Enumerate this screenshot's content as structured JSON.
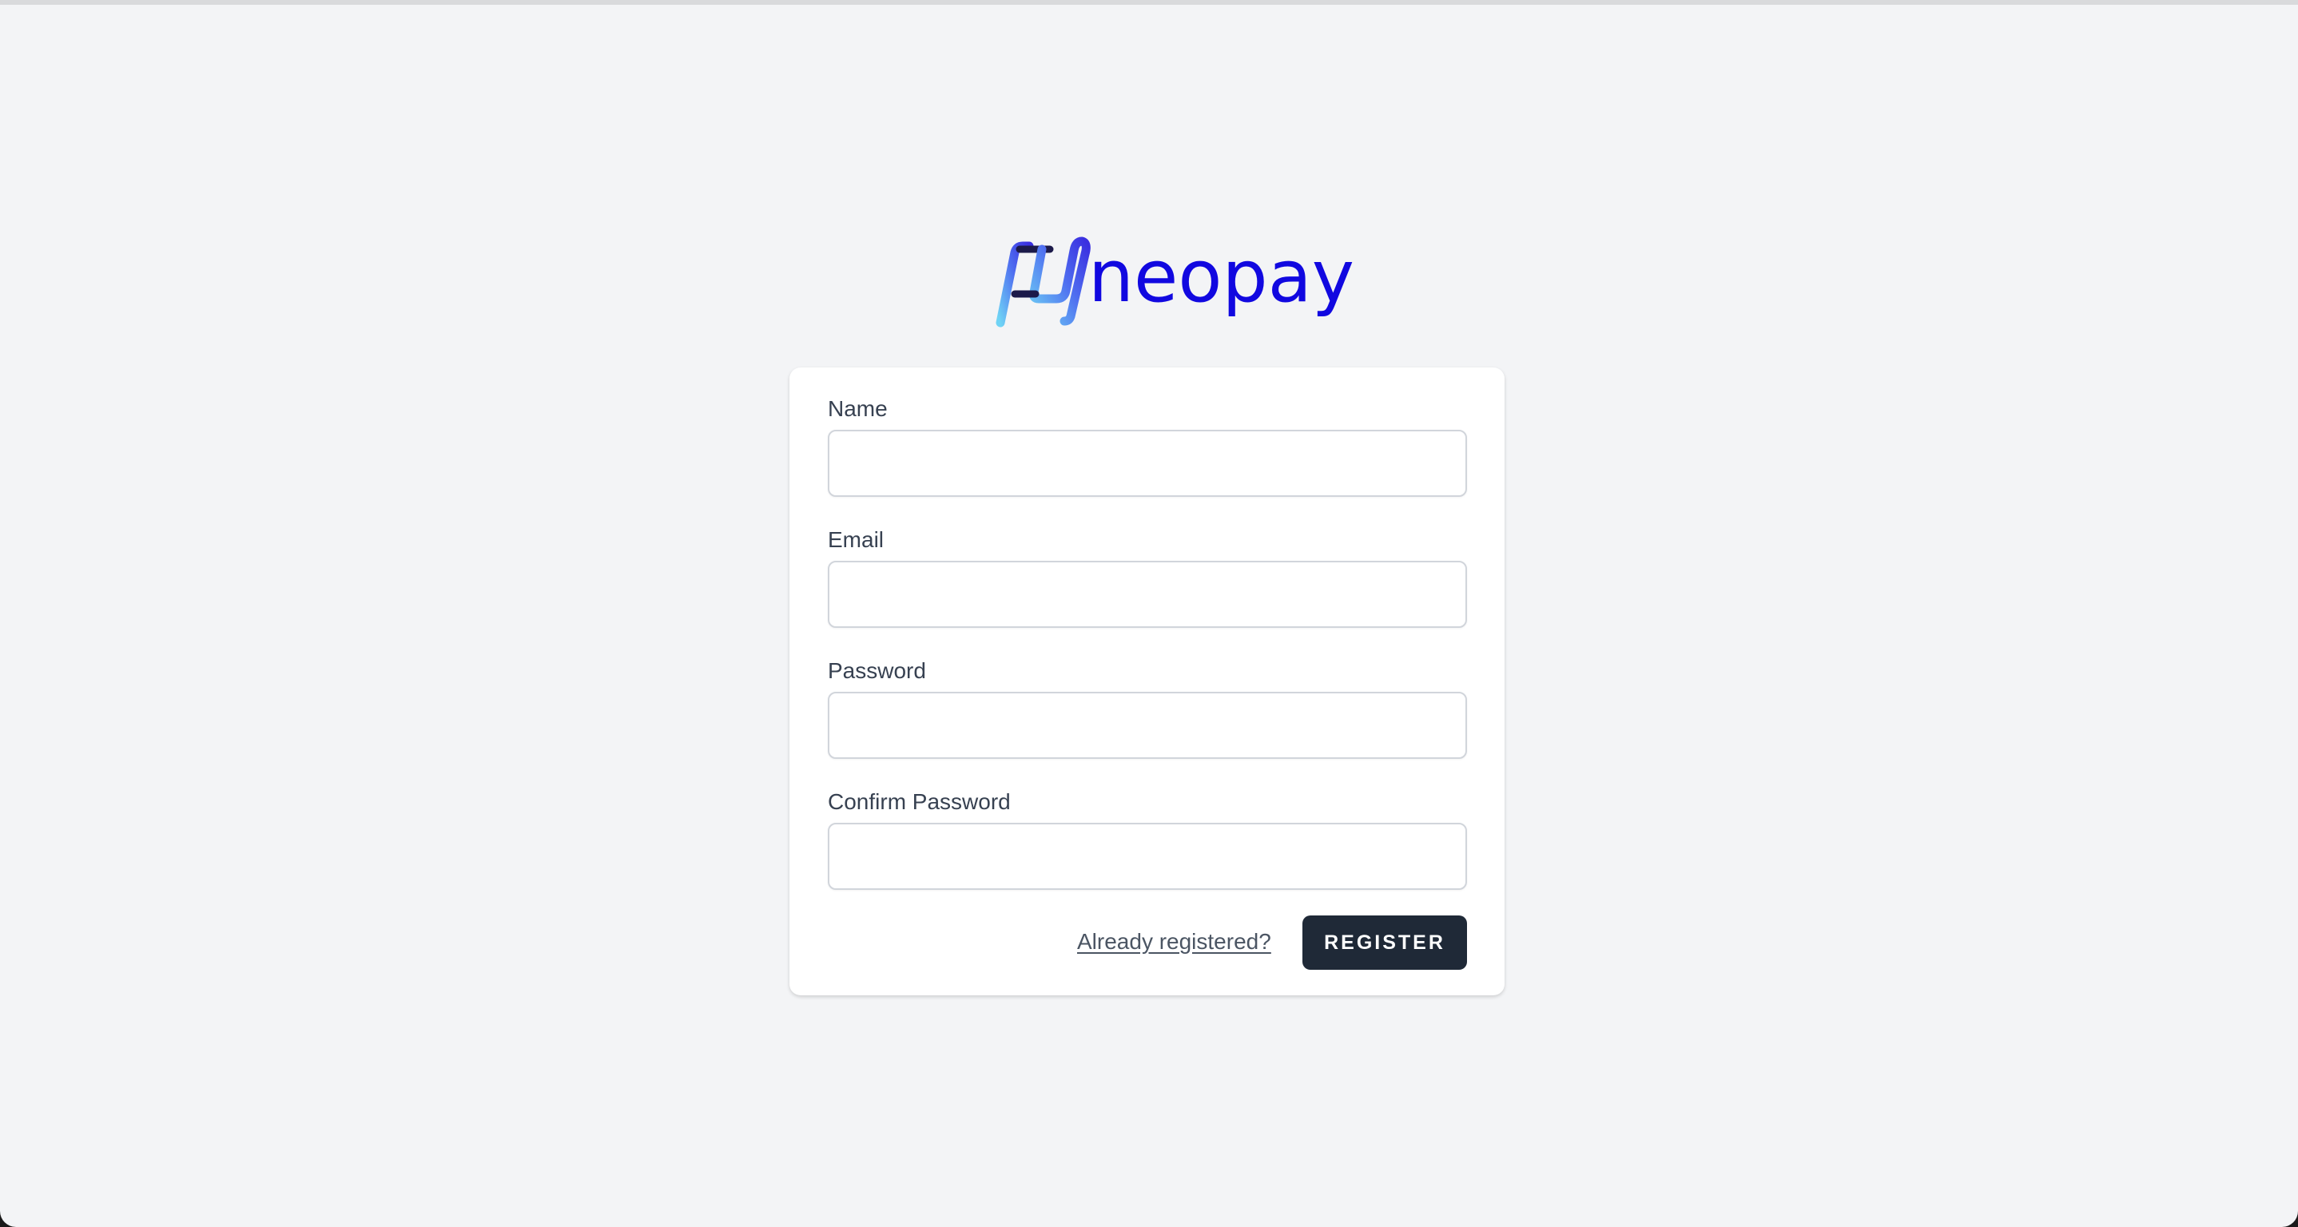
{
  "brand": {
    "name": "neopay",
    "color": "#1108e0"
  },
  "form": {
    "fields": [
      {
        "label": "Name",
        "value": "",
        "placeholder": ""
      },
      {
        "label": "Email",
        "value": "",
        "placeholder": ""
      },
      {
        "label": "Password",
        "value": "",
        "placeholder": ""
      },
      {
        "label": "Confirm Password",
        "value": "",
        "placeholder": ""
      }
    ],
    "login_link": "Already registered?",
    "submit_label": "REGISTER"
  },
  "colors": {
    "background": "#f3f4f6",
    "card": "#ffffff",
    "button": "#1f2937",
    "label": "#374151"
  }
}
